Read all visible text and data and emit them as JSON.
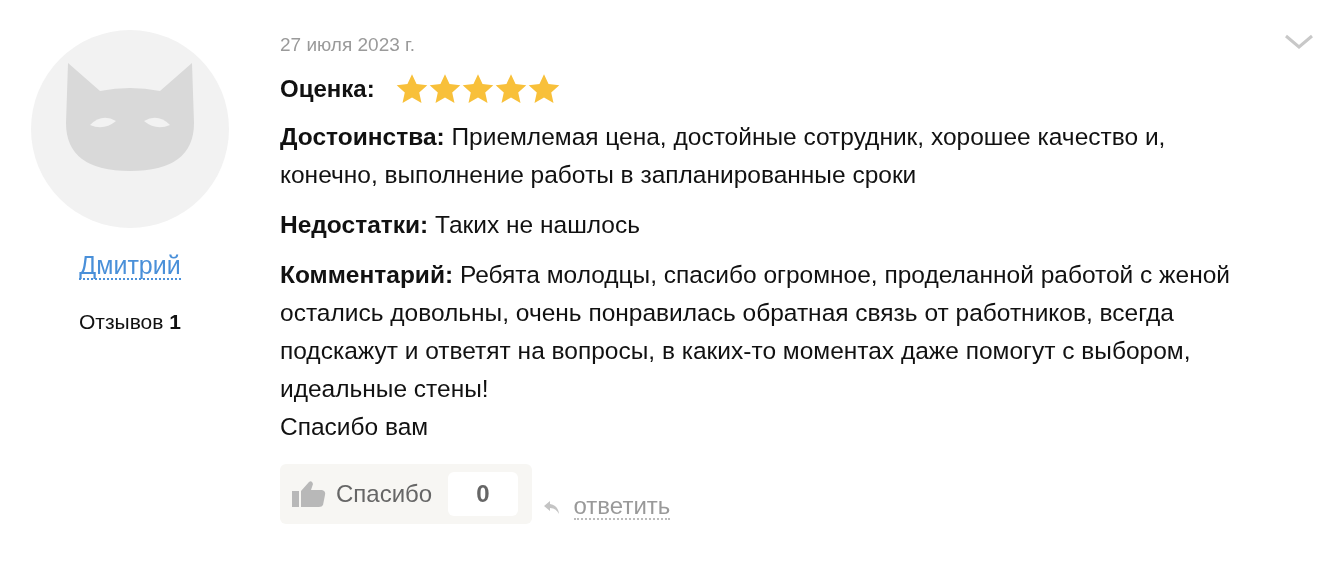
{
  "author": {
    "name": "Дмитрий",
    "reviews_label": "Отзывов",
    "reviews_count": "1"
  },
  "review": {
    "date": "27 июля 2023 г.",
    "rating_label": "Оценка:",
    "stars": 5,
    "fields": [
      {
        "label": "Достоинства:",
        "text": "Приемлемая цена, достойные сотрудник, хорошее качество и, конечно, выполнение работы в запланированные сроки"
      },
      {
        "label": "Недостатки:",
        "text": "Таких не нашлось"
      },
      {
        "label": "Комментарий:",
        "text": "Ребята молодцы, спасибо огромное, проделанной работой с женой остались довольны, очень понравилась обратная связь от работников, всегда подскажут и ответят на вопросы, в каких-то моментах даже помогут с выбором, идеальные стены!"
      }
    ],
    "closing": "Спасибо вам",
    "thanks_button": {
      "label": "Спасибо",
      "count": "0"
    },
    "reply_link": "ответить"
  }
}
